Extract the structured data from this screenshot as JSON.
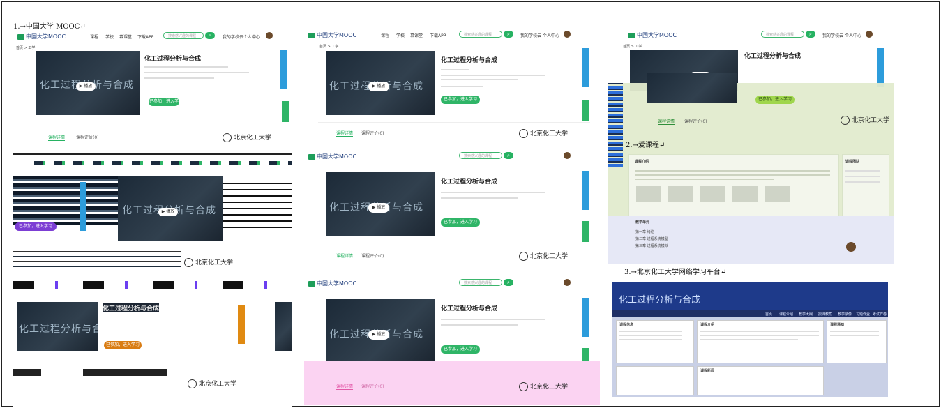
{
  "sections": {
    "s1": "1.→中国大学 MOOC↵",
    "s2": "2.→爱课程↵",
    "s3": "3.→北京化工大学网络学习平台↵"
  },
  "mooc": {
    "logo": "中国大学MOOC",
    "nav": [
      "课程",
      "学校",
      "慕课堂",
      "下载APP"
    ],
    "search_placeholder": "搜索感兴趣的课程",
    "my_school": "我的学校云",
    "personal": "个人中心",
    "breadcrumb": "首页 > 工学",
    "course_title": "化工过程分析与合成",
    "video_text": "化工过程分析与合成",
    "play_label": "▶ 播放",
    "enroll_label": "已参加，进入学习",
    "tab_intro": "课程详情",
    "tab_reviews": "课程评价(0)",
    "university": "北京化工大学"
  },
  "icourse": {
    "section_header": "课程介绍",
    "teachers_header": "课程团队",
    "outline_header": "教学单元",
    "lessons": [
      "第一章 绪论",
      "第二章 过程系统模型",
      "第三章 过程系统模拟"
    ]
  },
  "buct": {
    "title": "化工过程分析与合成",
    "nav": [
      "首页",
      "课程介绍",
      "教学大纲",
      "授课教案",
      "教学录像",
      "习题作业",
      "考试样卷"
    ],
    "left_header": "课程信息",
    "mid_header": "课程介绍",
    "right_header": "课程通知",
    "news_header": "课程新闻"
  },
  "colors": {
    "accent": "#27b262",
    "blue_bar": "#1e3a8a",
    "sidebar_blue": "#2d9cdb"
  }
}
